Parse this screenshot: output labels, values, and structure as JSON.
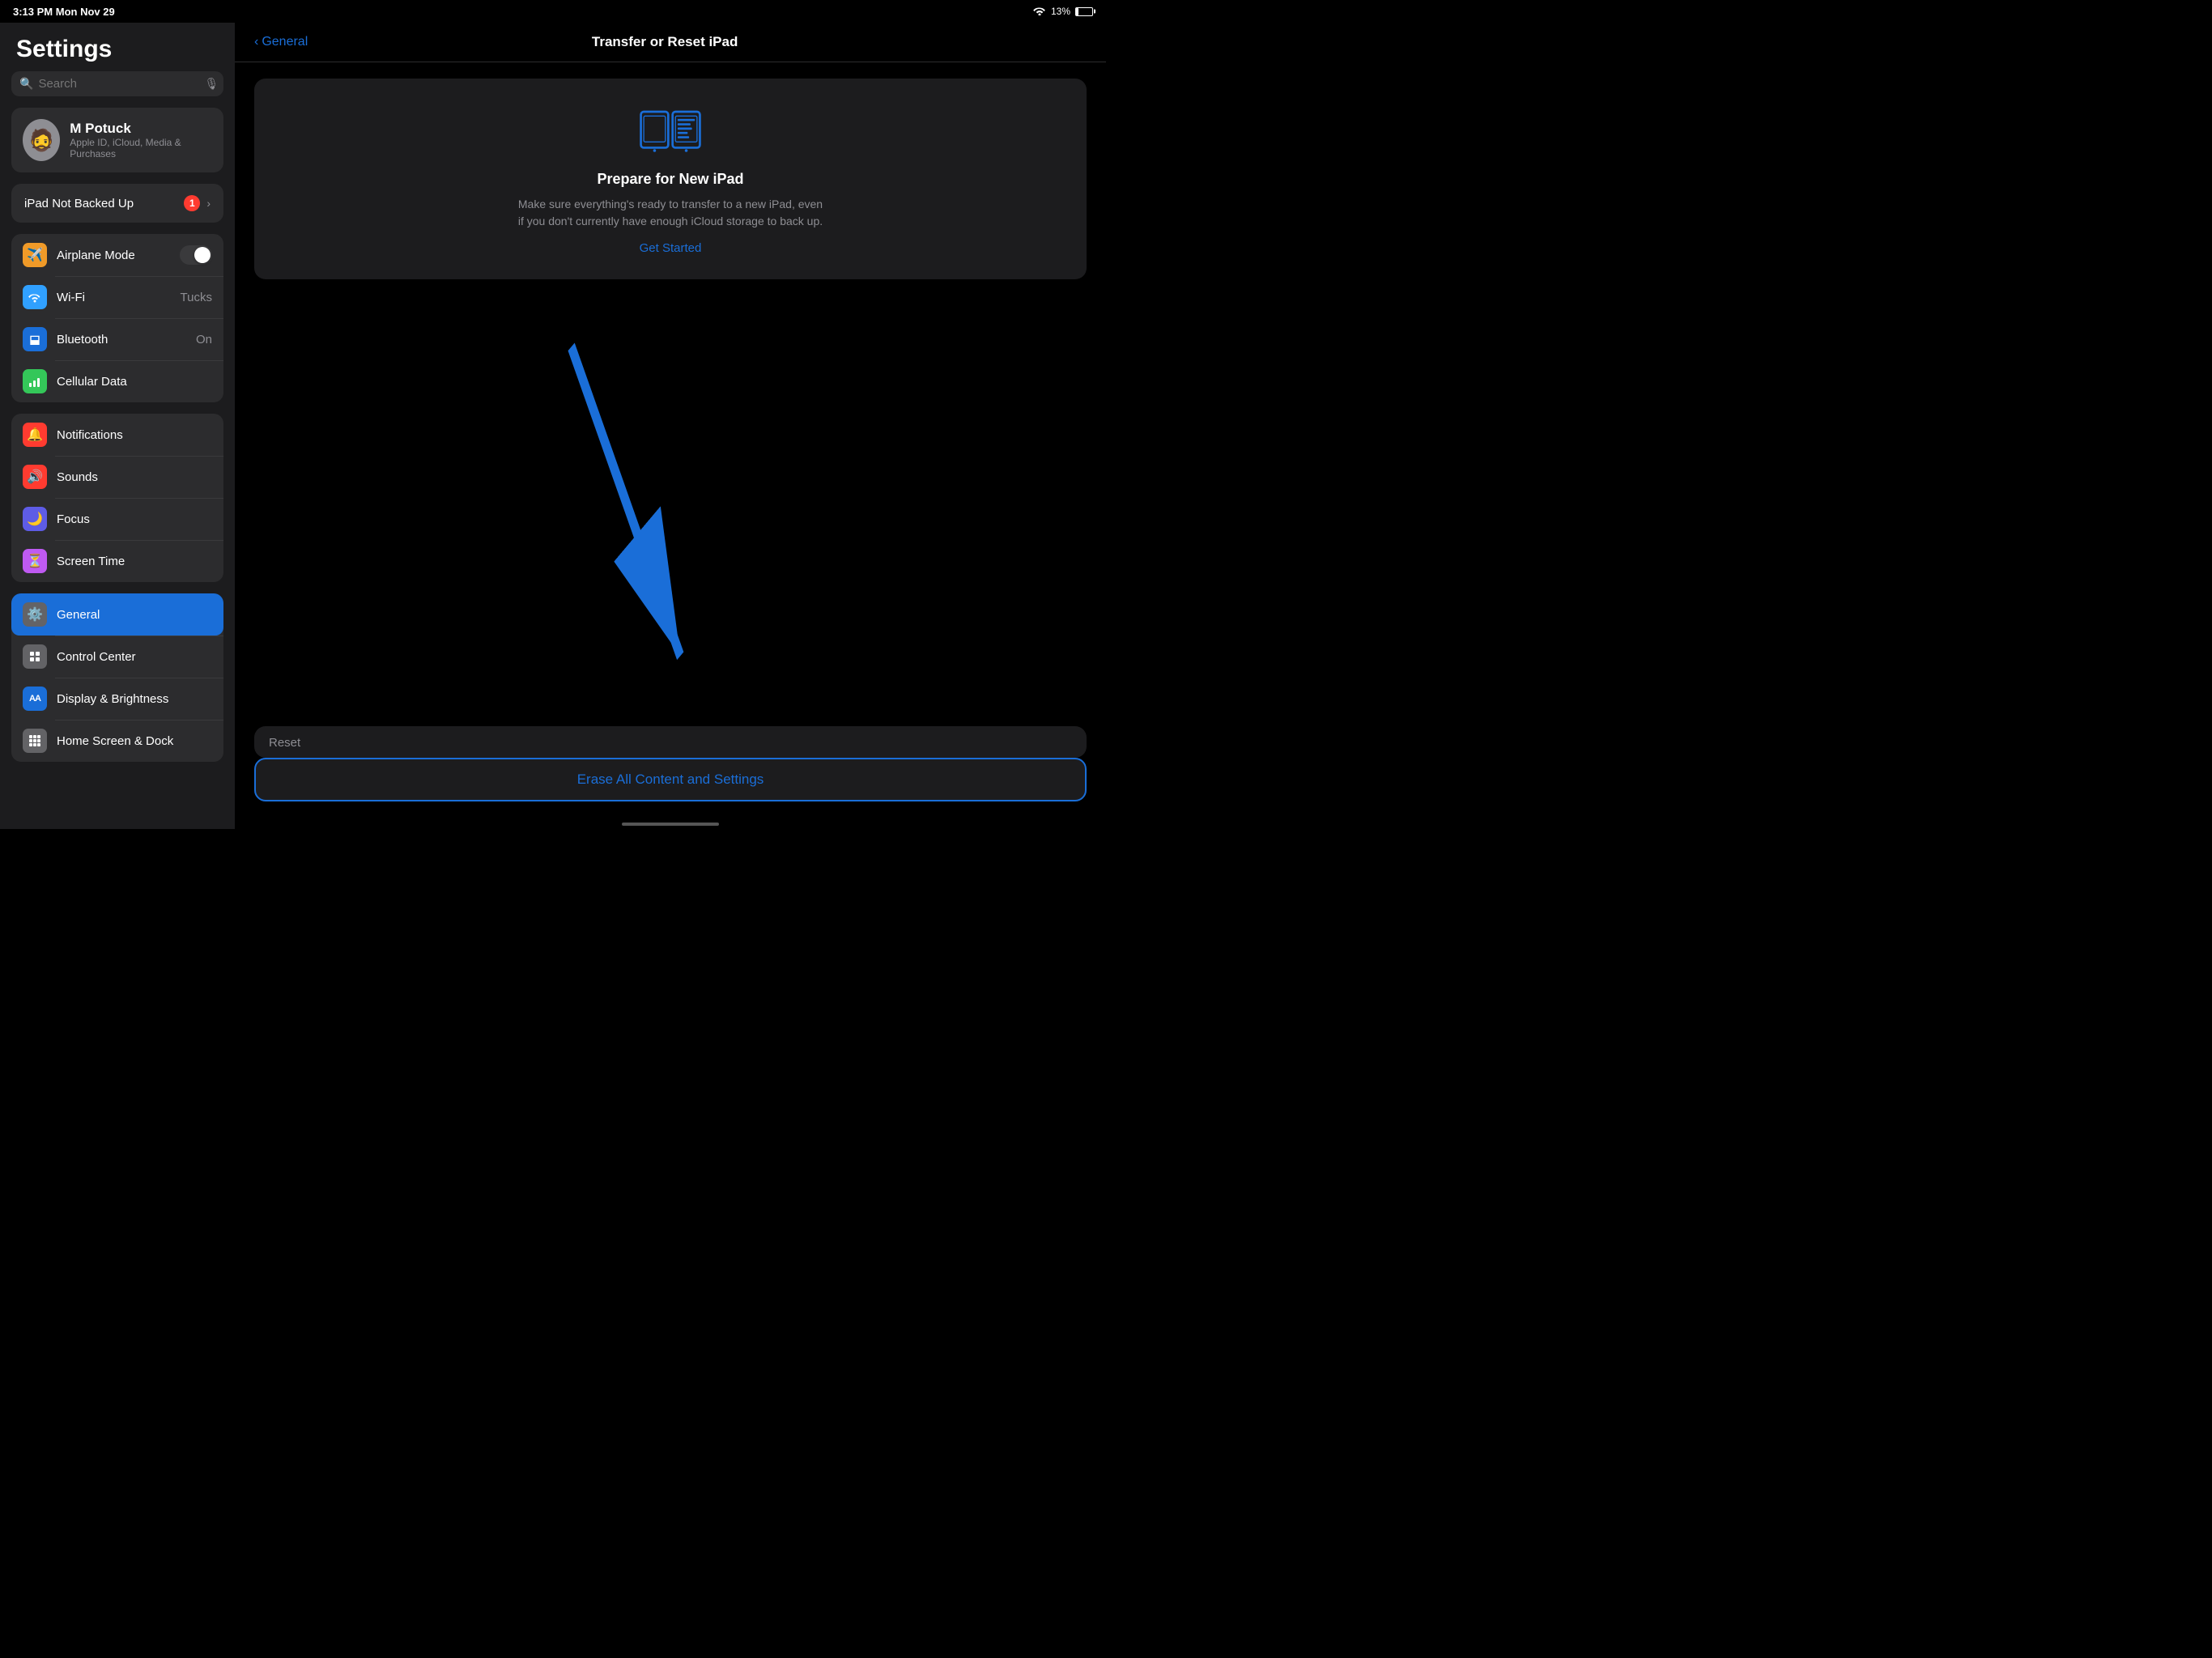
{
  "statusBar": {
    "time": "3:13 PM",
    "date": "Mon Nov 29",
    "wifi": "wifi",
    "battery": "13%"
  },
  "sidebar": {
    "title": "Settings",
    "search": {
      "placeholder": "Search"
    },
    "profile": {
      "name": "M Potuck",
      "subtitle": "Apple ID, iCloud, Media & Purchases",
      "emoji": "🧔"
    },
    "backupWarning": {
      "text": "iPad Not Backed Up",
      "badge": "1"
    },
    "group1": [
      {
        "id": "airplane",
        "label": "Airplane Mode",
        "iconColor": "icon-orange",
        "icon": "✈️",
        "hasToggle": true
      },
      {
        "id": "wifi",
        "label": "Wi-Fi",
        "iconColor": "icon-blue-lt",
        "icon": "📶",
        "value": "Tucks"
      },
      {
        "id": "bluetooth",
        "label": "Bluetooth",
        "iconColor": "icon-blue",
        "icon": "🔷",
        "value": "On"
      },
      {
        "id": "cellular",
        "label": "Cellular Data",
        "iconColor": "icon-green",
        "icon": "📡",
        "value": ""
      }
    ],
    "group2": [
      {
        "id": "notifications",
        "label": "Notifications",
        "iconColor": "icon-red",
        "icon": "🔔",
        "value": ""
      },
      {
        "id": "sounds",
        "label": "Sounds",
        "iconColor": "icon-red-snd",
        "icon": "🔊",
        "value": ""
      },
      {
        "id": "focus",
        "label": "Focus",
        "iconColor": "icon-purple",
        "icon": "🌙",
        "value": ""
      },
      {
        "id": "screentime",
        "label": "Screen Time",
        "iconColor": "icon-purple-st",
        "icon": "⏳",
        "value": ""
      }
    ],
    "group3": [
      {
        "id": "general",
        "label": "General",
        "iconColor": "icon-gray",
        "icon": "⚙️",
        "value": "",
        "active": true
      },
      {
        "id": "controlcenter",
        "label": "Control Center",
        "iconColor": "icon-gray",
        "icon": "⬜",
        "value": ""
      },
      {
        "id": "display",
        "label": "Display & Brightness",
        "iconColor": "icon-blue-aa",
        "icon": "AA",
        "value": ""
      },
      {
        "id": "homescreen",
        "label": "Home Screen & Dock",
        "iconColor": "icon-gray",
        "icon": "⊞",
        "value": ""
      }
    ]
  },
  "mainPanel": {
    "backLabel": "General",
    "title": "Transfer or Reset iPad",
    "prepareCard": {
      "title": "Prepare for New iPad",
      "description": "Make sure everything's ready to transfer to a new iPad, even if you don't currently have enough iCloud storage to back up.",
      "getStarted": "Get Started"
    },
    "resetSection": {
      "headerLabel": "Reset",
      "eraseButton": "Erase All Content and Settings"
    }
  },
  "homeIndicator": {}
}
